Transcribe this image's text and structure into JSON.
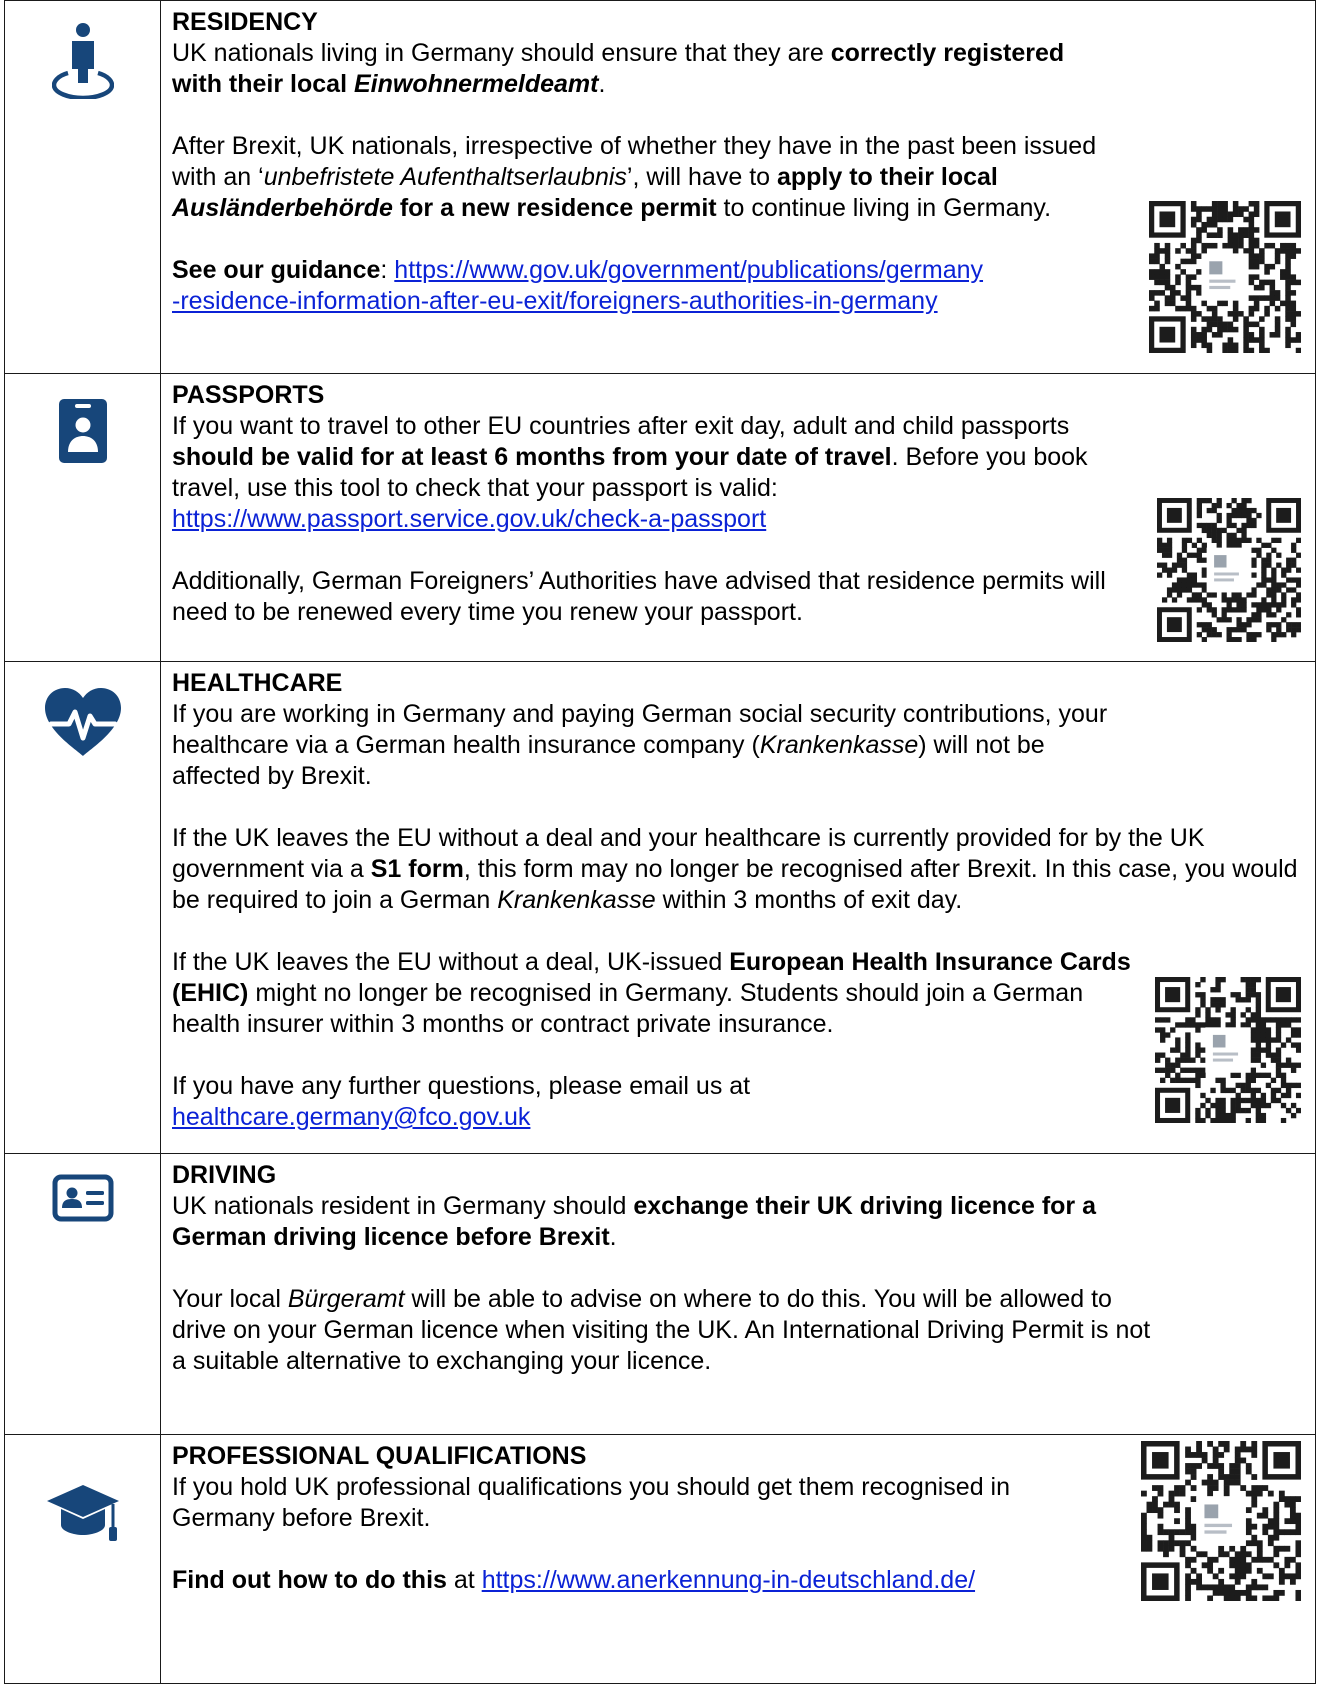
{
  "sections": [
    {
      "icon": "person-location-icon",
      "heading": "RESIDENCY",
      "p1": {
        "t1": "UK nationals living in Germany should ensure that they are ",
        "b1": "correctly registered with their local ",
        "bi1": "Einwohnermeldeamt",
        "t2": "."
      },
      "p2": {
        "t1": "After Brexit, UK nationals, irrespective of whether they have in the past been issued with an ‘",
        "i1": "unbefristete Aufenthaltserlaubnis",
        "t2": "’, will have to ",
        "b1": "apply to their local ",
        "bi1": "Ausländerbehörde",
        "b2": " for a new residence permit",
        "t3": " to continue living in Germany."
      },
      "p3": {
        "b1": "See our guidance",
        "t1": ": ",
        "link": "https://www.gov.uk/government/publications/germany-residence-information-after-eu-exit/foreigners-authorities-in-germany",
        "link_line1": "https://www.gov.uk/government/publications/germany",
        "link_line2": "-residence-information-after-eu-exit/foreigners-authorities-in-germany"
      }
    },
    {
      "icon": "passport-id-icon",
      "heading": "PASSPORTS",
      "p1": {
        "t1": "If you want to travel to other EU countries after exit day, adult and child passports ",
        "b1": "should be valid for at least 6 months from your date of travel",
        "t2": ". Before you book travel, use this tool to check that your passport is valid: ",
        "link": "https://www.passport.service.gov.uk/check-a-passport"
      },
      "p2": {
        "t1": "Additionally, German Foreigners’ Authorities have advised that residence permits will need to be renewed every time you renew your passport."
      }
    },
    {
      "icon": "heart-pulse-icon",
      "heading": "HEALTHCARE",
      "p1": {
        "t1": "If you are working in Germany and paying German social security contributions, your healthcare via a German health insurance company (",
        "i1": "Krankenkasse",
        "t2": ") will not be affected by Brexit."
      },
      "p2": {
        "t1": "If the UK leaves the EU without a deal and your healthcare is currently provided for by the UK government via a ",
        "b1": "S1 form",
        "t2": ", this form may no longer be recognised after Brexit.  In this case, you would be required to join a German ",
        "i1": "Krankenkasse",
        "t3": " within 3 months of exit day."
      },
      "p3": {
        "t1": "If the UK leaves the EU without a deal, UK-issued ",
        "b1": "European Health Insurance Cards (EHIC)",
        "t2": " might no longer be recognised in Germany. Students should join a German health insurer within 3 months or contract private insurance."
      },
      "p4": {
        "t1": "If you have any further questions, please email us at ",
        "link": "healthcare.germany@fco.gov.uk"
      }
    },
    {
      "icon": "driving-licence-card-icon",
      "heading": "DRIVING",
      "p1": {
        "t1": "UK nationals resident in Germany should ",
        "b1": "exchange their UK driving licence for a German driving licence before Brexit",
        "t2": "."
      },
      "p2": {
        "t1": "Your local ",
        "i1": "Bürgeramt",
        "t2": " will be able to advise on where to do this.  You will be allowed to drive on your German licence when visiting the UK.  An International Driving Permit is not a suitable alternative to exchanging your licence."
      }
    },
    {
      "icon": "graduation-cap-icon",
      "heading": "PROFESSIONAL QUALIFICATIONS",
      "p1": {
        "t1": "If you hold UK professional qualifications you should get them recognised in Germany before Brexit."
      },
      "p2": {
        "b1": "Find out how to do this",
        "t1": " at ",
        "link": "https://www.anerkennung-in-deutschland.de/"
      }
    }
  ],
  "colors": {
    "icon": "#17467a",
    "link": "#0b22d6",
    "border": "#1a1a1a"
  }
}
